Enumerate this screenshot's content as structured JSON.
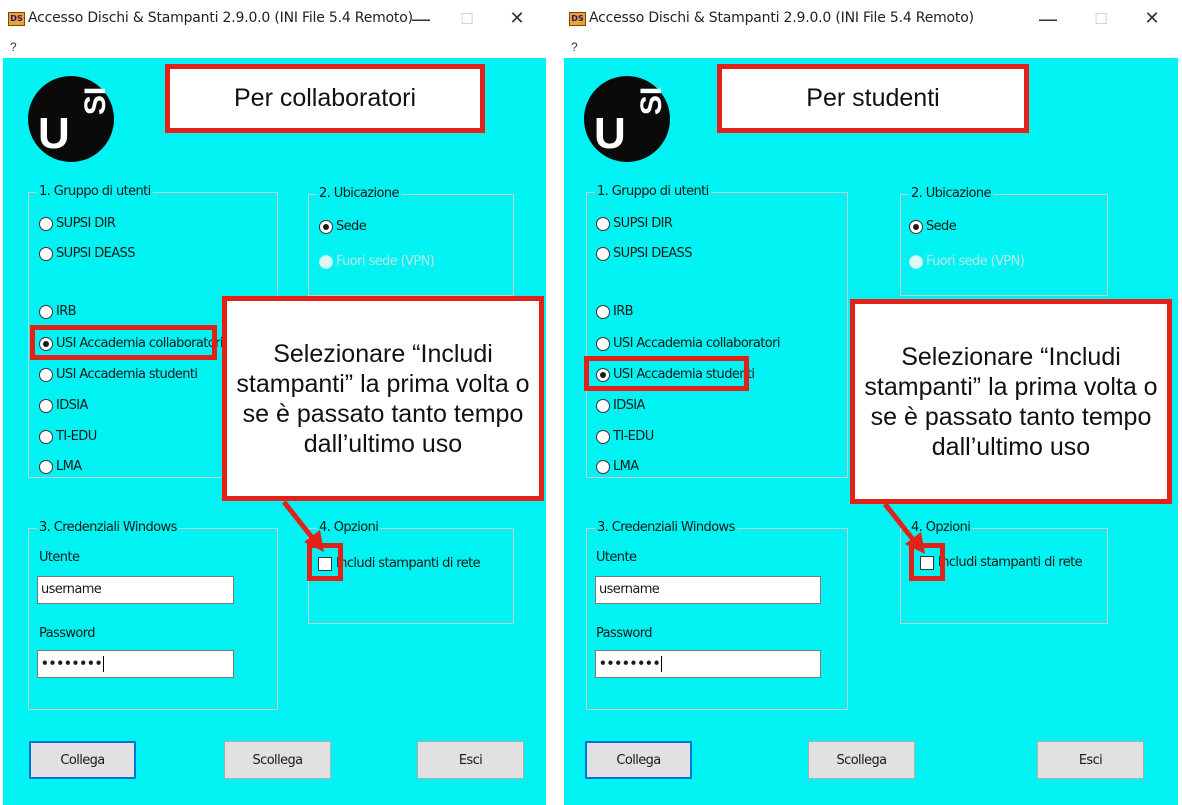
{
  "window": {
    "title": "Accesso Dischi & Stampanti 2.9.0.0 (INI File 5.4 Remoto)",
    "icon_text": "DS",
    "help_menu": "?",
    "minimize_icon": "minimize-icon",
    "maximize_icon": "maximize-icon",
    "close_icon": "close-icon"
  },
  "logo": {
    "u": "U",
    "si": "SI"
  },
  "groups": {
    "gruppo": "1. Gruppo di utenti",
    "ubicazione": "2. Ubicazione",
    "credenziali": "3. Credenziali Windows",
    "opzioni": "4. Opzioni"
  },
  "user_groups": [
    "SUPSI DIR",
    "SUPSI DEASS",
    "IRB",
    "USI Accademia collaboratori",
    "USI Accademia studenti",
    "IDSIA",
    "TI-EDU",
    "LMA"
  ],
  "locations": {
    "sede": "Sede",
    "vpn": "Fuori sede (VPN)"
  },
  "options": {
    "include_printers": "Includi stampanti di rete"
  },
  "credentials": {
    "user_label": "Utente",
    "user_value": "username",
    "password_label": "Password",
    "password_value": "••••••••"
  },
  "buttons": {
    "connect": "Collega",
    "disconnect": "Scollega",
    "exit": "Esci"
  },
  "panels": [
    {
      "header": "Per collaboratori",
      "selected_group": "USI Accademia collaboratori"
    },
    {
      "header": "Per studenti",
      "selected_group": "USI Accademia studenti"
    }
  ],
  "callout": "Selezionare “Includi stampanti” la prima volta o se è passato tanto tempo dall’ultimo uso",
  "colors": {
    "background": "#00f2f2",
    "highlight": "#e32119",
    "default_button_border": "#0078d7"
  }
}
